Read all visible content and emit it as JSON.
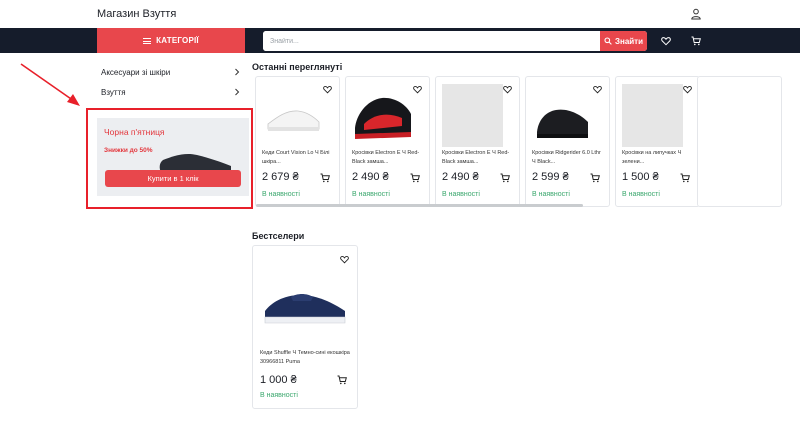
{
  "header": {
    "logo": "Магазин Взуття",
    "user_icon": "user-icon"
  },
  "nav": {
    "categories_label": "КАТЕГОРІЇ",
    "search_placeholder": "Знайти...",
    "search_button": "Знайти",
    "wishlist_icon": "heart-icon",
    "cart_icon": "cart-icon"
  },
  "sidebar": {
    "items": [
      {
        "label": "Аксесуари зі шкіри"
      },
      {
        "label": "Взуття"
      }
    ]
  },
  "promo": {
    "title": "Чорна п'ятниця",
    "subtitle": "Знижки до 50%",
    "button": "Купити в 1 клік"
  },
  "recent": {
    "title": "Останні переглянуті",
    "products": [
      {
        "name": "Кеди Court Vision Lo Ч Білі шкіра...",
        "price": "2 679 ₴",
        "stock": "В наявності",
        "image": "white-sneaker"
      },
      {
        "name": "Кросівки Electron E Ч Red-Black замша...",
        "price": "2 490 ₴",
        "stock": "В наявності",
        "image": "black-red-sneaker"
      },
      {
        "name": "Кросівки Electron E Ч Red-Black замша...",
        "price": "2 490 ₴",
        "stock": "В наявності",
        "image": "placeholder"
      },
      {
        "name": "Кросівки Ridgerider 6.0 Lthr Ч Black...",
        "price": "2 599 ₴",
        "stock": "В наявності",
        "image": "black-sneaker"
      },
      {
        "name": "Кросівки на липучках Ч зелени...",
        "price": "1 500 ₴",
        "stock": "В наявності",
        "image": "placeholder"
      }
    ]
  },
  "bestsellers": {
    "title": "Бестселери",
    "products": [
      {
        "name": "Кеди Shuffle Ч Темно-сині екошкіра 30966811 Puma",
        "price": "1 000 ₴",
        "stock": "В наявності",
        "image": "navy-sneaker"
      }
    ]
  },
  "colors": {
    "accent": "#e8474c",
    "navbar": "#151c2b",
    "stock_green": "#3aa76d",
    "highlight": "#e8202a"
  }
}
